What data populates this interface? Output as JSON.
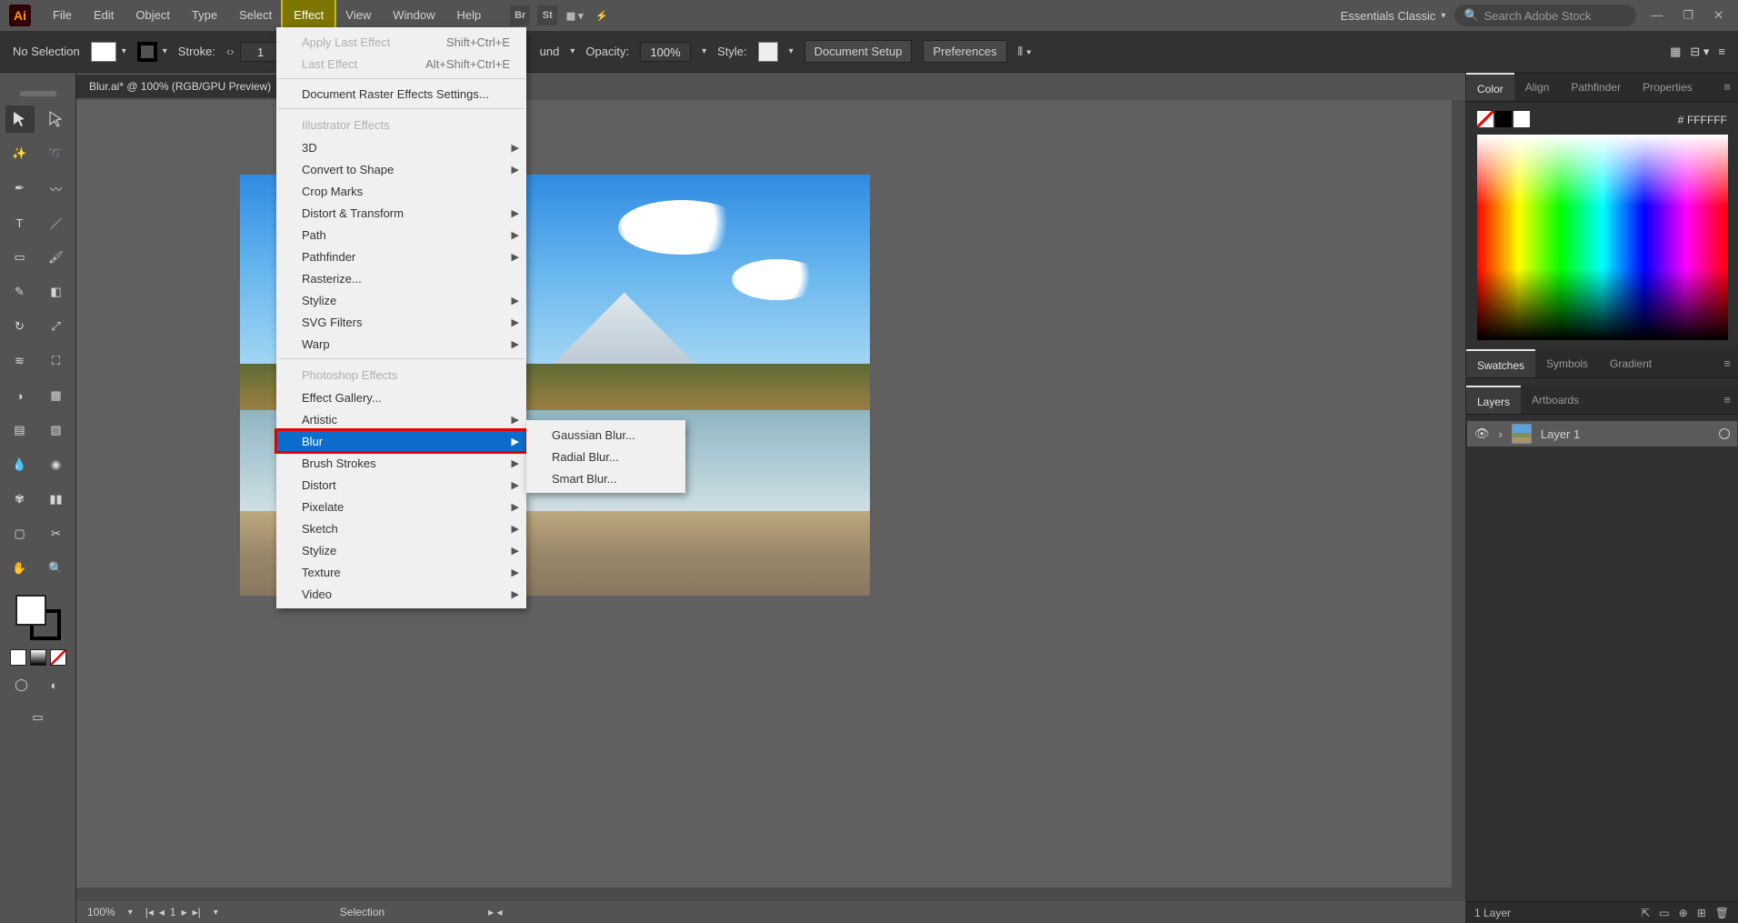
{
  "app": {
    "logo": "Ai"
  },
  "menu": {
    "items": [
      "File",
      "Edit",
      "Object",
      "Type",
      "Select",
      "Effect",
      "View",
      "Window",
      "Help"
    ],
    "active_index": 5
  },
  "workspace": {
    "label": "Essentials Classic"
  },
  "search": {
    "placeholder": "Search Adobe Stock"
  },
  "options": {
    "selection": "No Selection",
    "stroke_label": "Stroke:",
    "stroke_value": "1",
    "opacity_label": "Opacity:",
    "opacity_value": "100%",
    "style_label": "Style:",
    "docsetup": "Document Setup",
    "prefs": "Preferences",
    "und_label": "und"
  },
  "document": {
    "tab": "Blur.ai* @ 100% (RGB/GPU Preview)"
  },
  "effect_menu": {
    "apply_last": "Apply Last Effect",
    "apply_last_sc": "Shift+Ctrl+E",
    "last_effect": "Last Effect",
    "last_effect_sc": "Alt+Shift+Ctrl+E",
    "raster_settings": "Document Raster Effects Settings...",
    "header_ill": "Illustrator Effects",
    "ill_items": [
      "3D",
      "Convert to Shape",
      "Crop Marks",
      "Distort & Transform",
      "Path",
      "Pathfinder",
      "Rasterize...",
      "Stylize",
      "SVG Filters",
      "Warp"
    ],
    "ill_arrows": [
      true,
      true,
      false,
      true,
      true,
      true,
      false,
      true,
      true,
      true
    ],
    "header_ps": "Photoshop Effects",
    "ps_items": [
      "Effect Gallery...",
      "Artistic",
      "Blur",
      "Brush Strokes",
      "Distort",
      "Pixelate",
      "Sketch",
      "Stylize",
      "Texture",
      "Video"
    ],
    "ps_arrows": [
      false,
      true,
      true,
      true,
      true,
      true,
      true,
      true,
      true,
      true
    ],
    "highlighted_ps_index": 2
  },
  "blur_submenu": {
    "items": [
      "Gaussian Blur...",
      "Radial Blur...",
      "Smart Blur..."
    ]
  },
  "panels": {
    "color_tabs": [
      "Color",
      "Align",
      "Pathfinder",
      "Properties"
    ],
    "color_active": 0,
    "hex_prefix": "#",
    "hex_value": "FFFFFF",
    "swatches_tabs": [
      "Swatches",
      "Symbols",
      "Gradient"
    ],
    "swatches_active": 0,
    "layers_tabs": [
      "Layers",
      "Artboards"
    ],
    "layers_active": 0,
    "layer_name": "Layer 1",
    "layer_count": "1 Layer"
  },
  "status": {
    "zoom": "100%",
    "artboard": "1",
    "mode": "Selection"
  }
}
